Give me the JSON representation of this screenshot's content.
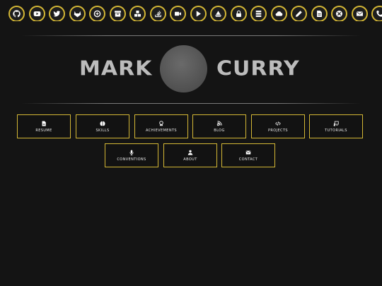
{
  "social_links": [
    {
      "icon": "github-icon"
    },
    {
      "icon": "youtube-icon"
    },
    {
      "icon": "twitter-icon"
    },
    {
      "icon": "gitlab-icon"
    },
    {
      "icon": "codewars-icon"
    },
    {
      "icon": "archive-icon"
    },
    {
      "icon": "cubes-icon"
    },
    {
      "icon": "stackoverflow-icon"
    },
    {
      "icon": "video-icon"
    },
    {
      "icon": "play-icon"
    },
    {
      "icon": "ship-icon"
    },
    {
      "icon": "lock-icon"
    },
    {
      "icon": "server-icon"
    },
    {
      "icon": "cloud-icon"
    },
    {
      "icon": "pencil-icon"
    },
    {
      "icon": "file-icon"
    },
    {
      "icon": "xbox-icon"
    },
    {
      "icon": "mail-icon"
    },
    {
      "icon": "phone-icon"
    }
  ],
  "hero": {
    "first_name": "MARK",
    "last_name": "CURRY"
  },
  "nav": {
    "row1": [
      {
        "label": "RESUME",
        "icon": "file-icon"
      },
      {
        "label": "SKILLS",
        "icon": "brain-icon"
      },
      {
        "label": "ACHIEVEMENTS",
        "icon": "award-icon"
      },
      {
        "label": "BLOG",
        "icon": "blog-icon"
      },
      {
        "label": "PROJECTS",
        "icon": "code-icon"
      },
      {
        "label": "TUTORIALS",
        "icon": "chalkboard-icon"
      }
    ],
    "row2": [
      {
        "label": "CONVENTIONS",
        "icon": "microphone-icon"
      },
      {
        "label": "ABOUT",
        "icon": "user-icon"
      },
      {
        "label": "CONTACT",
        "icon": "envelope-icon"
      }
    ]
  },
  "colors": {
    "background": "#141414",
    "accent": "#d4b735",
    "name_text": "#bcbcbc",
    "avatar": "#5a5a5a"
  }
}
